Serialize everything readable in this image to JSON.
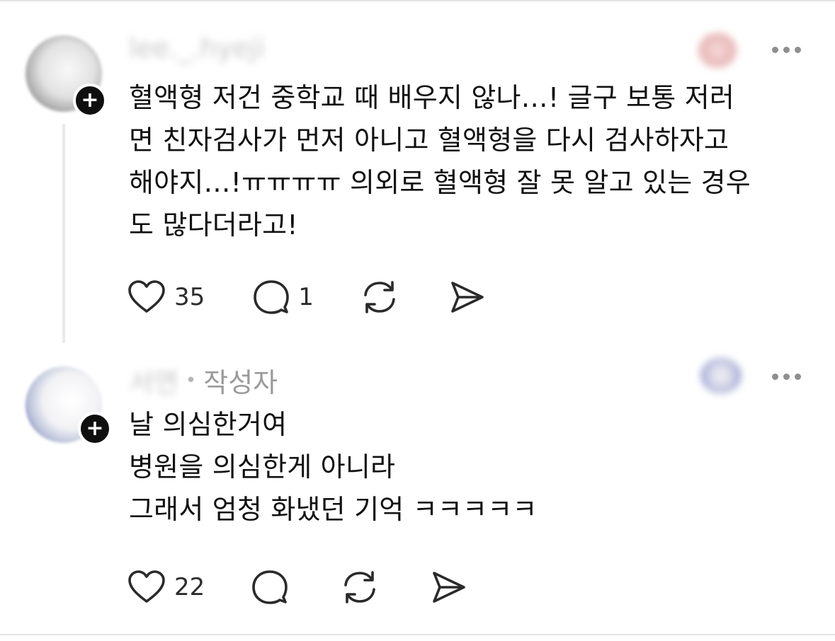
{
  "posts": [
    {
      "username": "lee._.hyeji",
      "text_lines": [
        "혈액형 저건 중학교 때 배우지 않나…! 글구 보통 저러",
        "면 친자검사가 먼저 아니고 혈액형을 다시 검사하자고",
        "해야지…!ㅠㅠㅠㅠ 의외로 혈액형 잘 못 알고 있는 경우",
        "도 많다더라고!"
      ],
      "likes": "35",
      "replies": "1"
    },
    {
      "username": "서연",
      "author_tag": "작성자",
      "text_lines": [
        "날 의심한거여",
        "병원을 의심한게 아니라",
        "그래서 엄청 화냈던 기억 ㅋㅋㅋㅋㅋ"
      ],
      "likes": "22",
      "replies": ""
    }
  ],
  "icons": {
    "like": "heart-icon",
    "reply": "speech-bubble-icon",
    "repost": "repost-icon",
    "share": "send-icon",
    "more": "more-horizontal-icon",
    "follow": "plus-icon"
  },
  "badge_symbol": "+"
}
